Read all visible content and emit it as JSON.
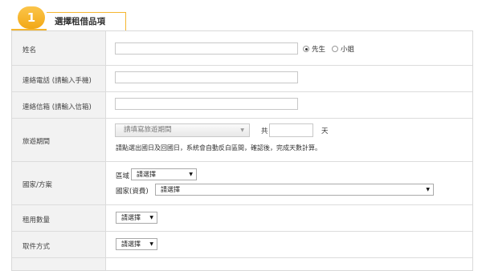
{
  "step": {
    "number": "1",
    "title": "選擇租借品項"
  },
  "fields": {
    "name": {
      "label": "姓名",
      "value": "",
      "gender_options": [
        "先生",
        "小姐"
      ],
      "gender_selected": "先生"
    },
    "phone": {
      "label": "連絡電話 (請輸入手機)",
      "value": ""
    },
    "email": {
      "label": "連絡信箱 (請輸入信箱)",
      "value": ""
    },
    "travel": {
      "label": "旅遊期間",
      "period_placeholder": "請填寫旅遊期間",
      "total_prefix": "共",
      "days_value": "",
      "days_suffix": "天",
      "hint": "請點選出國日及回國日，系統會自動反白區間，確認後，完成天數計算。"
    },
    "country": {
      "label": "國家/方案",
      "region_label": "區域",
      "region_selected": "請選擇",
      "country_label": "國家(資費)",
      "country_selected": "請選擇"
    },
    "quantity": {
      "label": "租用數量",
      "selected": "請選擇"
    },
    "pickup": {
      "label": "取件方式",
      "selected": "請選擇"
    }
  },
  "icons": {
    "dropdown": "▼"
  }
}
